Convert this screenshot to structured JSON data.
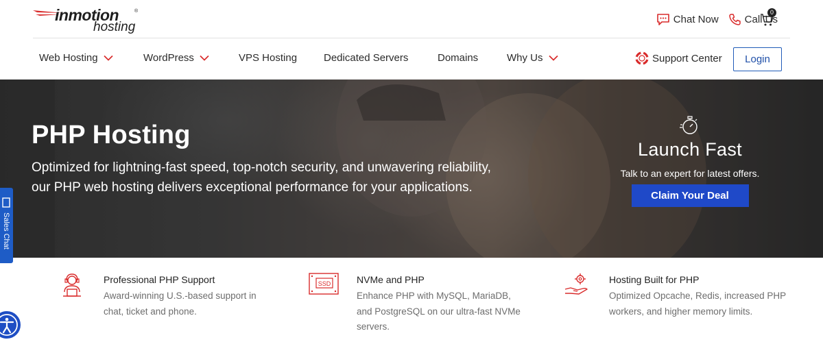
{
  "brand": {
    "logo_word": "inmotion",
    "logo_sub": "hosting",
    "logo_mark": "®"
  },
  "top_actions": {
    "chat": "Chat Now",
    "call": "Call Us",
    "cart_count": "0"
  },
  "nav": {
    "items": [
      {
        "label": "Web Hosting",
        "dropdown": true
      },
      {
        "label": "WordPress",
        "dropdown": true
      },
      {
        "label": "VPS Hosting",
        "dropdown": false
      },
      {
        "label": "Dedicated Servers",
        "dropdown": false
      },
      {
        "label": "Domains",
        "dropdown": false
      },
      {
        "label": "Why Us",
        "dropdown": true
      }
    ],
    "support": "Support Center",
    "login": "Login"
  },
  "hero": {
    "title": "PHP Hosting",
    "description": "Optimized for lightning-fast speed, top-notch security, and unwavering reliability, our PHP web hosting delivers exceptional performance for your applications."
  },
  "launch": {
    "title": "Launch Fast",
    "subtitle": "Talk to an expert for latest offers.",
    "cta": "Claim Your Deal"
  },
  "sales_tab": {
    "label": "Sales Chat"
  },
  "features": [
    {
      "icon": "support-agent-icon",
      "title": "Professional PHP Support",
      "description": "Award-winning U.S.-based support in chat, ticket and phone."
    },
    {
      "icon": "ssd-drive-icon",
      "ssd_label": "SSD",
      "title": "NVMe and PHP",
      "description": "Enhance PHP with MySQL, MariaDB, and PostgreSQL on our ultra-fast NVMe servers."
    },
    {
      "icon": "hand-gear-icon",
      "title": "Hosting Built for PHP",
      "description": "Optimized Opcache, Redis, increased PHP workers, and higher memory limits."
    }
  ],
  "colors": {
    "accent_red": "#d92b2b",
    "brand_blue": "#1f49c8",
    "login_blue": "#1f5bb8"
  }
}
